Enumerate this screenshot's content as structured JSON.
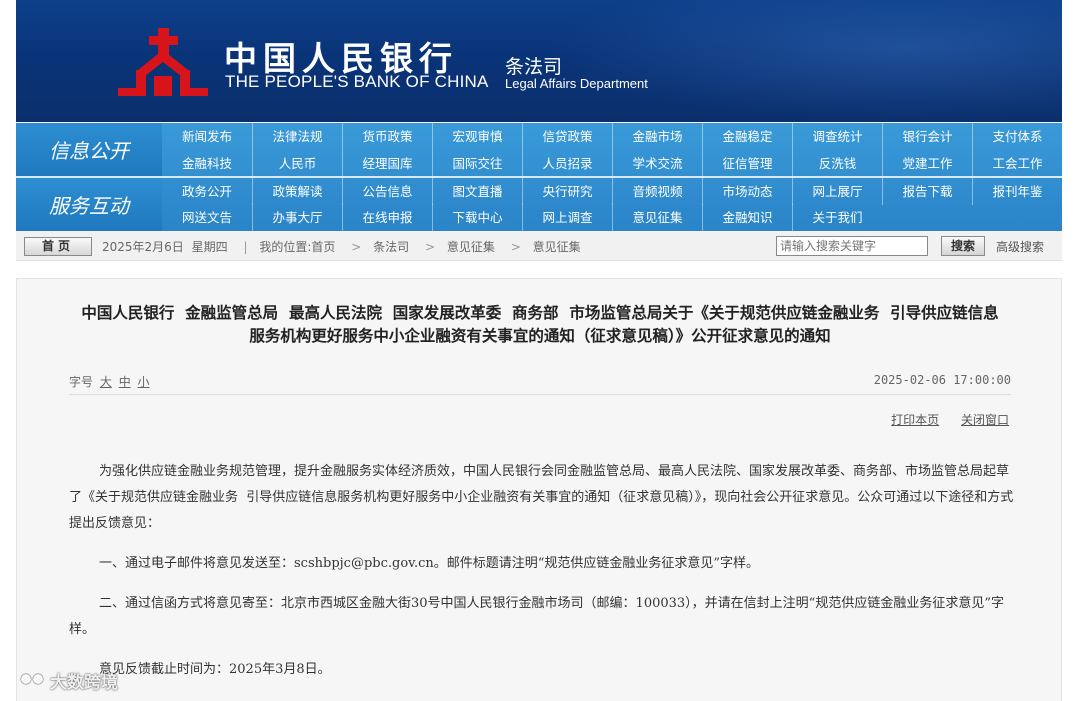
{
  "banner": {
    "logo_cn": "中国人民银行",
    "logo_en": "THE PEOPLE'S BANK OF CHINA",
    "dept_cn": "条法司",
    "dept_en": "Legal Affairs Department"
  },
  "nav": {
    "section_info": "信息公开",
    "section_service": "服务互动",
    "row1": [
      "新闻发布",
      "法律法规",
      "货币政策",
      "宏观审慎",
      "信贷政策",
      "金融市场",
      "金融稳定",
      "调查统计",
      "银行会计",
      "支付体系"
    ],
    "row2": [
      "金融科技",
      "人民币",
      "经理国库",
      "国际交往",
      "人员招录",
      "学术交流",
      "征信管理",
      "反洗钱",
      "党建工作",
      "工会工作"
    ],
    "row3": [
      "政务公开",
      "政策解读",
      "公告信息",
      "图文直播",
      "央行研究",
      "音频视频",
      "市场动态",
      "网上展厅",
      "报告下载",
      "报刊年鉴"
    ],
    "row4": [
      "网送文告",
      "办事大厅",
      "在线申报",
      "下载中心",
      "网上调查",
      "意见征集",
      "金融知识",
      "关于我们"
    ]
  },
  "crumb": {
    "home": "首页",
    "date": "2025年2月6日",
    "weekday": "星期四",
    "location_label": "我的位置:首页",
    "path": [
      "条法司",
      "意见征集",
      "意见征集"
    ],
    "search_placeholder": "请输入搜索关键字",
    "search_button": "搜索",
    "advanced": "高级搜索"
  },
  "article": {
    "title_line1": "中国人民银行  金融监管总局  最高人民法院  国家发展改革委  商务部  市场监管总局关于《关于规范供应链金融业务  引导供应链信息",
    "title_line2": "服务机构更好服务中小企业融资有关事宜的通知（征求意见稿）》公开征求意见的通知",
    "fontsize_label": "字号",
    "fontsize_large": "大",
    "fontsize_medium": "中",
    "fontsize_small": "小",
    "pubdate": "2025-02-06 17:00:00",
    "print": "打印本页",
    "close": "关闭窗口",
    "paragraphs": [
      "为强化供应链金融业务规范管理，提升金融服务实体经济质效，中国人民银行会同金融监管总局、最高人民法院、国家发展改革委、商务部、市场监管总局起草了《关于规范供应链金融业务  引导供应链信息服务机构更好服务中小企业融资有关事宜的通知（征求意见稿）》，现向社会公开征求意见。公众可通过以下途径和方式提出反馈意见：",
      "一、通过电子邮件将意见发送至：scshbpjc@pbc.gov.cn。邮件标题请注明“规范供应链金融业务征求意见”字样。",
      "二、通过信函方式将意见寄至：北京市西城区金融大街30号中国人民银行金融市场司（邮编：100033），并请在信封上注明“规范供应链金融业务征求意见”字样。",
      "意见反馈截止时间为：2025年3月8日。"
    ]
  },
  "watermark": "大数跨境",
  "colors": {
    "banner_blue": "#0a3479",
    "nav_blue": "#2a84c8",
    "emblem_red": "#d8141b"
  }
}
